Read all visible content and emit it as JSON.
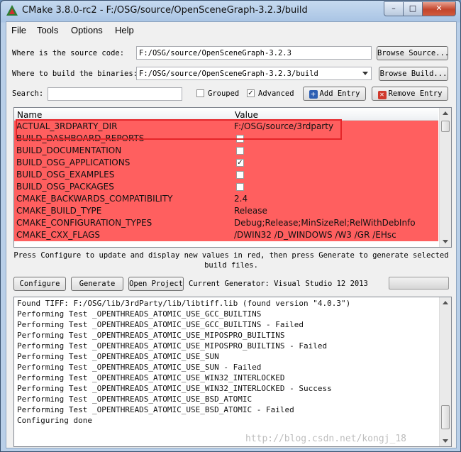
{
  "window": {
    "title": "CMake 3.8.0-rc2 - F:/OSG/source/OpenSceneGraph-3.2.3/build"
  },
  "title_buttons": {
    "minimize": "–",
    "maximize": "□",
    "close": "✕"
  },
  "menu": [
    "File",
    "Tools",
    "Options",
    "Help"
  ],
  "source": {
    "label": "Where is the source code:",
    "value": "F:/OSG/source/OpenSceneGraph-3.2.3",
    "button": "Browse Source..."
  },
  "build": {
    "label": "Where to build the binaries:",
    "value": "F:/OSG/source/OpenSceneGraph-3.2.3/build",
    "button": "Browse Build..."
  },
  "search": {
    "label": "Search:",
    "value": ""
  },
  "options": {
    "grouped_label": "Grouped",
    "grouped_checked": false,
    "advanced_label": "Advanced",
    "advanced_checked": true,
    "add_entry": "Add Entry",
    "remove_entry": "Remove Entry"
  },
  "table": {
    "columns": [
      "Name",
      "Value"
    ],
    "rows": [
      {
        "name": "ACTUAL_3RDPARTY_DIR",
        "value": "F:/OSG/source/3rdparty"
      },
      {
        "name": "BUILD_DASHBOARD_REPORTS",
        "value": "",
        "check": ""
      },
      {
        "name": "BUILD_DOCUMENTATION",
        "value": "",
        "check": ""
      },
      {
        "name": "BUILD_OSG_APPLICATIONS",
        "value": "",
        "check": "✓"
      },
      {
        "name": "BUILD_OSG_EXAMPLES",
        "value": "",
        "check": ""
      },
      {
        "name": "BUILD_OSG_PACKAGES",
        "value": "",
        "check": ""
      },
      {
        "name": "CMAKE_BACKWARDS_COMPATIBILITY",
        "value": "2.4"
      },
      {
        "name": "CMAKE_BUILD_TYPE",
        "value": "Release"
      },
      {
        "name": "CMAKE_CONFIGURATION_TYPES",
        "value": "Debug;Release;MinSizeRel;RelWithDebInfo"
      },
      {
        "name": "CMAKE_CXX_FLAGS",
        "value": "/DWIN32 /D_WINDOWS /W3 /GR /EHsc"
      }
    ],
    "row_color": "#ff5f5f"
  },
  "hint": {
    "line1": "Press Configure to update and display new values in red, then press Generate to generate selected",
    "line2": "build files."
  },
  "actions": {
    "configure": "Configure",
    "generate": "Generate",
    "open_project": "Open Project",
    "current_generator": "Current Generator: Visual Studio 12 2013"
  },
  "output": [
    "Found TIFF: F:/OSG/lib/3rdParty/lib/libtiff.lib (found version \"4.0.3\")",
    "Performing Test _OPENTHREADS_ATOMIC_USE_GCC_BUILTINS",
    "Performing Test _OPENTHREADS_ATOMIC_USE_GCC_BUILTINS - Failed",
    "Performing Test _OPENTHREADS_ATOMIC_USE_MIPOSPRO_BUILTINS",
    "Performing Test _OPENTHREADS_ATOMIC_USE_MIPOSPRO_BUILTINS - Failed",
    "Performing Test _OPENTHREADS_ATOMIC_USE_SUN",
    "Performing Test _OPENTHREADS_ATOMIC_USE_SUN - Failed",
    "Performing Test _OPENTHREADS_ATOMIC_USE_WIN32_INTERLOCKED",
    "Performing Test _OPENTHREADS_ATOMIC_USE_WIN32_INTERLOCKED - Success",
    "Performing Test _OPENTHREADS_ATOMIC_USE_BSD_ATOMIC",
    "Performing Test _OPENTHREADS_ATOMIC_USE_BSD_ATOMIC - Failed",
    "Configuring done"
  ],
  "watermark": "http://blog.csdn.net/kongj_18",
  "colors": {
    "accent_red": "#e5262a",
    "row_red": "#ff5f5f",
    "titlebar": "#b9cfe8"
  }
}
